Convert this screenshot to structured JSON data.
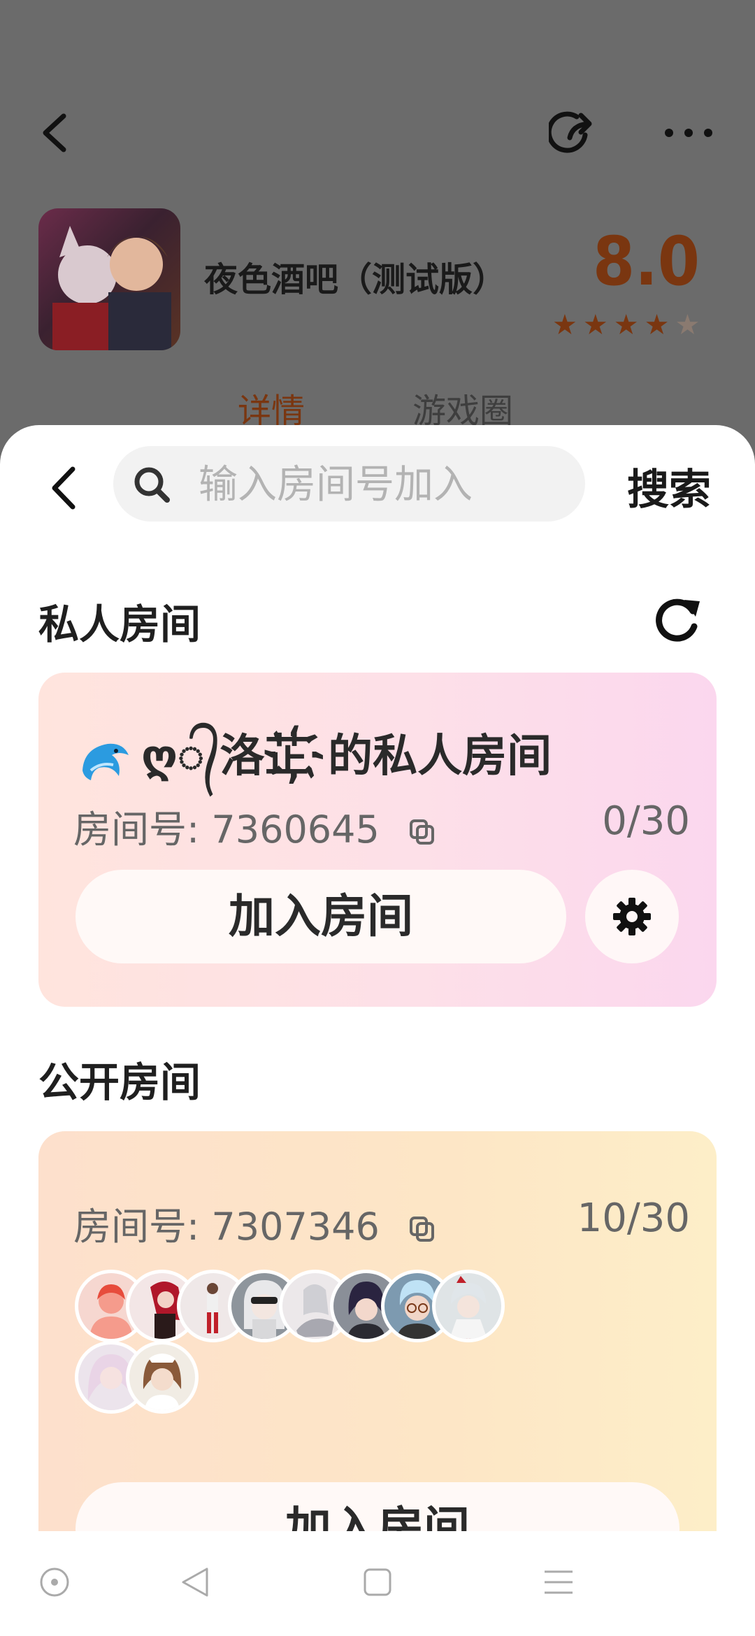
{
  "background_page": {
    "game_title": "夜色酒吧（测试版）",
    "score": "8.0",
    "rating_stars": 4,
    "rating_max": 5,
    "tabs": [
      "详情",
      "游戏圈"
    ],
    "icons": [
      "back-icon",
      "share-icon",
      "more-icon"
    ]
  },
  "search": {
    "placeholder": "输入房间号加入",
    "value": "",
    "button_label": "搜索"
  },
  "private_section": {
    "title": "私人房间",
    "room": {
      "name": "ღ᭄洛芷҉的私人房间",
      "room_number_label": "房间号:",
      "room_number": "7360645",
      "count": "0/30",
      "join_label": "加入房间"
    }
  },
  "public_section": {
    "title": "公开房间",
    "room": {
      "room_number_label": "房间号:",
      "room_number": "7307346",
      "count": "10/30",
      "join_label": "加入房间",
      "member_avatars": 10
    }
  },
  "colors": {
    "accent": "#7a3610",
    "star": "#7a3610",
    "private_card_start": "#ffe4dd",
    "private_card_end": "#fbd7ee",
    "public_card_start": "#fde0cc",
    "public_card_end": "#fdeec8"
  },
  "navbar": {
    "icons": [
      "nav-home-icon",
      "nav-back-icon",
      "nav-recents-icon",
      "nav-menu-icon"
    ]
  }
}
